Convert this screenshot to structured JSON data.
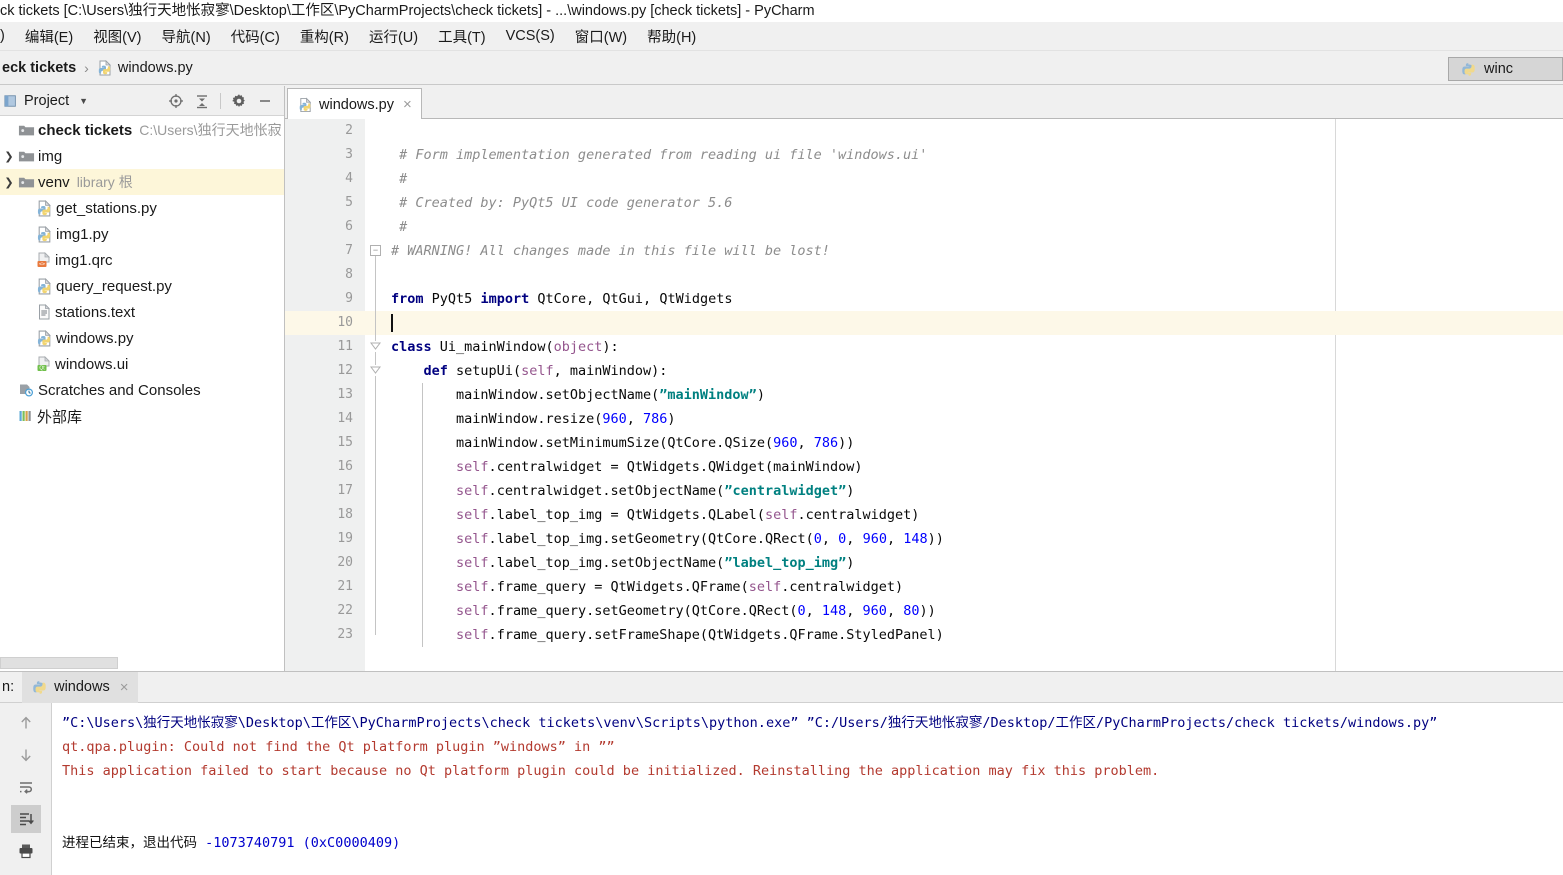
{
  "window": {
    "title": "ck tickets [C:\\Users\\独行天地怅寂寥\\Desktop\\工作区\\PyCharmProjects\\check tickets] - ...\\windows.py [check tickets] - PyCharm"
  },
  "menubar": {
    "items": [
      {
        "label": ")"
      },
      {
        "label": "编辑(E)"
      },
      {
        "label": "视图(V)"
      },
      {
        "label": "导航(N)"
      },
      {
        "label": "代码(C)"
      },
      {
        "label": "重构(R)"
      },
      {
        "label": "运行(U)"
      },
      {
        "label": "工具(T)"
      },
      {
        "label": "VCS(S)"
      },
      {
        "label": "窗口(W)"
      },
      {
        "label": "帮助(H)"
      }
    ]
  },
  "navbar": {
    "crumbs": [
      {
        "label": "eck tickets",
        "bold": true,
        "icon": ""
      },
      {
        "label": "windows.py",
        "bold": false,
        "icon": "python-file-icon"
      }
    ],
    "separator": "›"
  },
  "run_config": {
    "label": "winc",
    "icon": "python-icon"
  },
  "project_panel": {
    "title": "Project",
    "caret": "▼",
    "icon": "project-icon",
    "tools": [
      {
        "name": "locate-icon"
      },
      {
        "name": "collapse-all-icon"
      },
      {
        "name": "settings-gear-icon"
      },
      {
        "name": "minimize-icon"
      }
    ],
    "tree": [
      {
        "arrow": "",
        "icon": "folder-icon",
        "label": "check tickets",
        "bold": true,
        "sub": "C:\\Users\\独行天地怅寂",
        "indent": 0,
        "selected": false
      },
      {
        "arrow": "❯",
        "icon": "folder-icon",
        "label": "img",
        "bold": false,
        "sub": "",
        "indent": 1,
        "selected": false
      },
      {
        "arrow": "❯",
        "icon": "folder-icon",
        "label": "venv",
        "bold": false,
        "sub": "library 根",
        "indent": 1,
        "selected": true
      },
      {
        "arrow": "",
        "icon": "python-file-icon",
        "label": "get_stations.py",
        "bold": false,
        "sub": "",
        "indent": 2,
        "selected": false
      },
      {
        "arrow": "",
        "icon": "python-file-icon",
        "label": "img1.py",
        "bold": false,
        "sub": "",
        "indent": 2,
        "selected": false
      },
      {
        "arrow": "",
        "icon": "qrc-file-icon",
        "label": "img1.qrc",
        "bold": false,
        "sub": "",
        "indent": 2,
        "selected": false
      },
      {
        "arrow": "",
        "icon": "python-file-icon",
        "label": "query_request.py",
        "bold": false,
        "sub": "",
        "indent": 2,
        "selected": false
      },
      {
        "arrow": "",
        "icon": "text-file-icon",
        "label": "stations.text",
        "bold": false,
        "sub": "",
        "indent": 2,
        "selected": false
      },
      {
        "arrow": "",
        "icon": "python-file-icon",
        "label": "windows.py",
        "bold": false,
        "sub": "",
        "indent": 2,
        "selected": false
      },
      {
        "arrow": "",
        "icon": "qt-ui-file-icon",
        "label": "windows.ui",
        "bold": false,
        "sub": "",
        "indent": 2,
        "selected": false
      },
      {
        "arrow": "",
        "icon": "scratches-icon",
        "label": "Scratches and Consoles",
        "bold": false,
        "sub": "",
        "indent": 0,
        "selected": false
      },
      {
        "arrow": "",
        "icon": "external-libraries-icon",
        "label": "外部库",
        "bold": false,
        "sub": "",
        "indent": 0,
        "selected": false
      }
    ]
  },
  "editor": {
    "tab": {
      "label": "windows.py",
      "icon": "python-file-icon",
      "close": "×"
    },
    "current_line": 10,
    "lines": [
      {
        "n": 2,
        "text": ""
      },
      {
        "n": 3,
        "text": "# Form implementation generated from reading ui file 'windows.ui'",
        "style": "comment",
        "indent": 1
      },
      {
        "n": 4,
        "text": "#",
        "style": "comment",
        "indent": 1
      },
      {
        "n": 5,
        "text": "# Created by: PyQt5 UI code generator 5.6",
        "style": "comment",
        "indent": 1
      },
      {
        "n": 6,
        "text": "#",
        "style": "comment",
        "indent": 1
      },
      {
        "n": 7,
        "text": "# WARNING! All changes made in this file will be lost!",
        "style": "comment",
        "indent": 0
      },
      {
        "n": 8,
        "text": ""
      },
      {
        "n": 9,
        "text": "from PyQt5 import QtCore, QtGui, QtWidgets",
        "style": "import"
      },
      {
        "n": 10,
        "text": ""
      },
      {
        "n": 11,
        "text": "class Ui_mainWindow(object):",
        "style": "class"
      },
      {
        "n": 12,
        "text": "    def setupUi(self, mainWindow):",
        "style": "def"
      },
      {
        "n": 13,
        "text": "        mainWindow.setObjectName(\"mainWindow\")",
        "style": "stmt"
      },
      {
        "n": 14,
        "text": "        mainWindow.resize(960, 786)",
        "style": "stmt"
      },
      {
        "n": 15,
        "text": "        mainWindow.setMinimumSize(QtCore.QSize(960, 786))",
        "style": "stmt"
      },
      {
        "n": 16,
        "text": "        self.centralwidget = QtWidgets.QWidget(mainWindow)",
        "style": "stmt"
      },
      {
        "n": 17,
        "text": "        self.centralwidget.setObjectName(\"centralwidget\")",
        "style": "stmt"
      },
      {
        "n": 18,
        "text": "        self.label_top_img = QtWidgets.QLabel(self.centralwidget)",
        "style": "stmt"
      },
      {
        "n": 19,
        "text": "        self.label_top_img.setGeometry(QtCore.QRect(0, 0, 960, 148))",
        "style": "stmt"
      },
      {
        "n": 20,
        "text": "        self.label_top_img.setObjectName(\"label_top_img\")",
        "style": "stmt"
      },
      {
        "n": 21,
        "text": "        self.frame_query = QtWidgets.QFrame(self.centralwidget)",
        "style": "stmt"
      },
      {
        "n": 22,
        "text": "        self.frame_query.setGeometry(QtCore.QRect(0, 148, 960, 80))",
        "style": "stmt"
      },
      {
        "n": 23,
        "text": "        self.frame_query.setFrameShape(QtWidgets.QFrame.StyledPanel)",
        "style": "stmt"
      }
    ]
  },
  "run_panel": {
    "label": "n:",
    "tab": {
      "label": "windows",
      "icon": "python-icon",
      "close": "×"
    },
    "toolbar": [
      {
        "name": "up-arrow-icon",
        "glyph": "↑",
        "active": false
      },
      {
        "name": "down-arrow-icon",
        "glyph": "↓",
        "active": false
      },
      {
        "name": "soft-wrap-icon",
        "glyph": "",
        "active": false
      },
      {
        "name": "scroll-to-end-icon",
        "glyph": "",
        "active": true
      },
      {
        "name": "print-icon",
        "glyph": "",
        "active": false
      }
    ],
    "console": [
      {
        "text": "\"C:\\Users\\独行天地怅寂寥\\Desktop\\工作区\\PyCharmProjects\\check tickets\\venv\\Scripts\\python.exe\" \"C:/Users/独行天地怅寂寥/Desktop/工作区/PyCharmProjects/check tickets/windows.py\"",
        "kind": "command"
      },
      {
        "text": "qt.qpa.plugin: Could not find the Qt platform plugin \"windows\" in \"\"",
        "kind": "error"
      },
      {
        "text": "This application failed to start because no Qt platform plugin could be initialized. Reinstalling the application may fix this problem.",
        "kind": "error"
      },
      {
        "text": "",
        "kind": "blank"
      },
      {
        "text": "",
        "kind": "blank"
      },
      {
        "text": "进程已结束，退出代码 -1073740791 (0xC0000409)",
        "kind": "done"
      }
    ]
  },
  "colors": {
    "accent_selection": "#fdf6d9",
    "current_line": "#fdf8e8",
    "comment": "#8c8c8c",
    "keyword": "#000080",
    "string": "#008080",
    "number": "#0000ff",
    "self": "#94558d",
    "console_error": "#b33a2f",
    "console_command": "#000080",
    "panel_bg": "#f0f0f0",
    "editor_bg": "#ffffff"
  }
}
